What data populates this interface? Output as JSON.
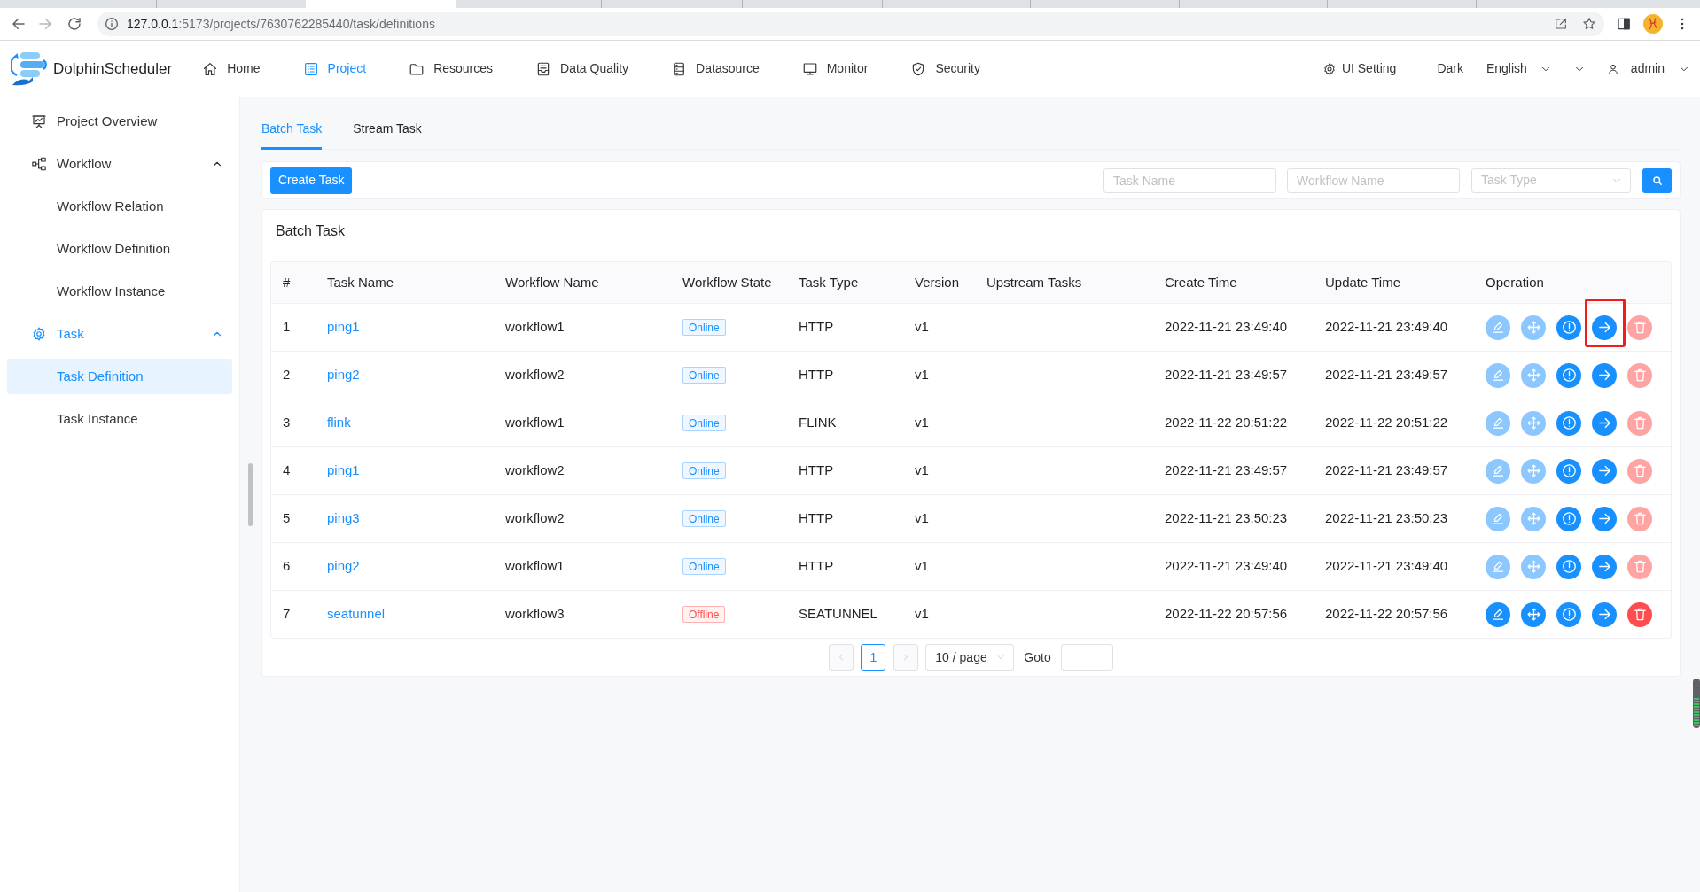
{
  "browser": {
    "url": {
      "host": "127.0.0.1",
      "path": ":5173/projects/7630762285440/task/definitions"
    }
  },
  "header": {
    "brand": "DolphinScheduler",
    "nav": [
      {
        "label": "Home",
        "selected": false
      },
      {
        "label": "Project",
        "selected": true
      },
      {
        "label": "Resources",
        "selected": false
      },
      {
        "label": "Data Quality",
        "selected": false
      },
      {
        "label": "Datasource",
        "selected": false
      },
      {
        "label": "Monitor",
        "selected": false
      },
      {
        "label": "Security",
        "selected": false
      }
    ],
    "ui_setting": "UI Setting",
    "theme": "Dark",
    "language": "English",
    "user": "admin"
  },
  "sidebar": {
    "items": [
      {
        "label": "Project Overview",
        "kind": "link",
        "selected": false
      },
      {
        "label": "Workflow",
        "kind": "group",
        "selected": false,
        "expanded": true,
        "children": [
          {
            "label": "Workflow Relation",
            "selected": false
          },
          {
            "label": "Workflow Definition",
            "selected": false
          },
          {
            "label": "Workflow Instance",
            "selected": false
          }
        ]
      },
      {
        "label": "Task",
        "kind": "group",
        "selected": true,
        "expanded": true,
        "children": [
          {
            "label": "Task Definition",
            "selected": true
          },
          {
            "label": "Task Instance",
            "selected": false
          }
        ]
      }
    ]
  },
  "tabs": [
    {
      "label": "Batch Task",
      "selected": true
    },
    {
      "label": "Stream Task",
      "selected": false
    }
  ],
  "toolbar": {
    "create_button": "Create Task",
    "filters": [
      {
        "kind": "input",
        "placeholder": "Task Name"
      },
      {
        "kind": "input",
        "placeholder": "Workflow Name"
      },
      {
        "kind": "select",
        "placeholder": "Task Type"
      }
    ]
  },
  "table": {
    "title": "Batch Task",
    "columns": [
      "#",
      "Task Name",
      "Workflow Name",
      "Workflow State",
      "Task Type",
      "Version",
      "Upstream Tasks",
      "Create Time",
      "Update Time",
      "Operation"
    ],
    "rows": [
      {
        "number": "1",
        "task_name": "ping1",
        "workflow_name": "workflow1",
        "state": {
          "label": "Online",
          "kind": "online"
        },
        "task_type": "HTTP",
        "version": "v1",
        "create_time": "2022-11-21 23:49:40",
        "update_time": "2022-11-21 23:49:40",
        "operations": [
          {
            "kind": "edit",
            "disabled": true,
            "annotated": false
          },
          {
            "kind": "move",
            "disabled": true,
            "annotated": false
          },
          {
            "kind": "info",
            "disabled": false,
            "annotated": false
          },
          {
            "kind": "forward",
            "disabled": false,
            "annotated": true
          },
          {
            "kind": "delete",
            "disabled": true,
            "annotated": false
          }
        ]
      },
      {
        "number": "2",
        "task_name": "ping2",
        "workflow_name": "workflow2",
        "state": {
          "label": "Online",
          "kind": "online"
        },
        "task_type": "HTTP",
        "version": "v1",
        "create_time": "2022-11-21 23:49:57",
        "update_time": "2022-11-21 23:49:57",
        "operations": [
          {
            "kind": "edit",
            "disabled": true,
            "annotated": false
          },
          {
            "kind": "move",
            "disabled": true,
            "annotated": false
          },
          {
            "kind": "info",
            "disabled": false,
            "annotated": false
          },
          {
            "kind": "forward",
            "disabled": false,
            "annotated": false
          },
          {
            "kind": "delete",
            "disabled": true,
            "annotated": false
          }
        ]
      },
      {
        "number": "3",
        "task_name": "flink",
        "workflow_name": "workflow1",
        "state": {
          "label": "Online",
          "kind": "online"
        },
        "task_type": "FLINK",
        "version": "v1",
        "create_time": "2022-11-22 20:51:22",
        "update_time": "2022-11-22 20:51:22",
        "operations": [
          {
            "kind": "edit",
            "disabled": true,
            "annotated": false
          },
          {
            "kind": "move",
            "disabled": true,
            "annotated": false
          },
          {
            "kind": "info",
            "disabled": false,
            "annotated": false
          },
          {
            "kind": "forward",
            "disabled": false,
            "annotated": false
          },
          {
            "kind": "delete",
            "disabled": true,
            "annotated": false
          }
        ]
      },
      {
        "number": "4",
        "task_name": "ping1",
        "workflow_name": "workflow2",
        "state": {
          "label": "Online",
          "kind": "online"
        },
        "task_type": "HTTP",
        "version": "v1",
        "create_time": "2022-11-21 23:49:57",
        "update_time": "2022-11-21 23:49:57",
        "operations": [
          {
            "kind": "edit",
            "disabled": true,
            "annotated": false
          },
          {
            "kind": "move",
            "disabled": true,
            "annotated": false
          },
          {
            "kind": "info",
            "disabled": false,
            "annotated": false
          },
          {
            "kind": "forward",
            "disabled": false,
            "annotated": false
          },
          {
            "kind": "delete",
            "disabled": true,
            "annotated": false
          }
        ]
      },
      {
        "number": "5",
        "task_name": "ping3",
        "workflow_name": "workflow2",
        "state": {
          "label": "Online",
          "kind": "online"
        },
        "task_type": "HTTP",
        "version": "v1",
        "create_time": "2022-11-21 23:50:23",
        "update_time": "2022-11-21 23:50:23",
        "operations": [
          {
            "kind": "edit",
            "disabled": true,
            "annotated": false
          },
          {
            "kind": "move",
            "disabled": true,
            "annotated": false
          },
          {
            "kind": "info",
            "disabled": false,
            "annotated": false
          },
          {
            "kind": "forward",
            "disabled": false,
            "annotated": false
          },
          {
            "kind": "delete",
            "disabled": true,
            "annotated": false
          }
        ]
      },
      {
        "number": "6",
        "task_name": "ping2",
        "workflow_name": "workflow1",
        "state": {
          "label": "Online",
          "kind": "online"
        },
        "task_type": "HTTP",
        "version": "v1",
        "create_time": "2022-11-21 23:49:40",
        "update_time": "2022-11-21 23:49:40",
        "operations": [
          {
            "kind": "edit",
            "disabled": true,
            "annotated": false
          },
          {
            "kind": "move",
            "disabled": true,
            "annotated": false
          },
          {
            "kind": "info",
            "disabled": false,
            "annotated": false
          },
          {
            "kind": "forward",
            "disabled": false,
            "annotated": false
          },
          {
            "kind": "delete",
            "disabled": true,
            "annotated": false
          }
        ]
      },
      {
        "number": "7",
        "task_name": "seatunnel",
        "workflow_name": "workflow3",
        "state": {
          "label": "Offline",
          "kind": "offline"
        },
        "task_type": "SEATUNNEL",
        "version": "v1",
        "create_time": "2022-11-22 20:57:56",
        "update_time": "2022-11-22 20:57:56",
        "operations": [
          {
            "kind": "edit",
            "disabled": false,
            "annotated": false
          },
          {
            "kind": "move",
            "disabled": false,
            "annotated": false
          },
          {
            "kind": "info",
            "disabled": false,
            "annotated": false
          },
          {
            "kind": "forward",
            "disabled": false,
            "annotated": false
          },
          {
            "kind": "delete",
            "disabled": false,
            "annotated": false
          }
        ]
      }
    ]
  },
  "pagination": {
    "prev": {
      "disabled": true
    },
    "pages": [
      {
        "label": "1",
        "selected": true
      }
    ],
    "next": {
      "disabled": true
    },
    "page_size": "10 / page",
    "goto_label": "Goto"
  }
}
